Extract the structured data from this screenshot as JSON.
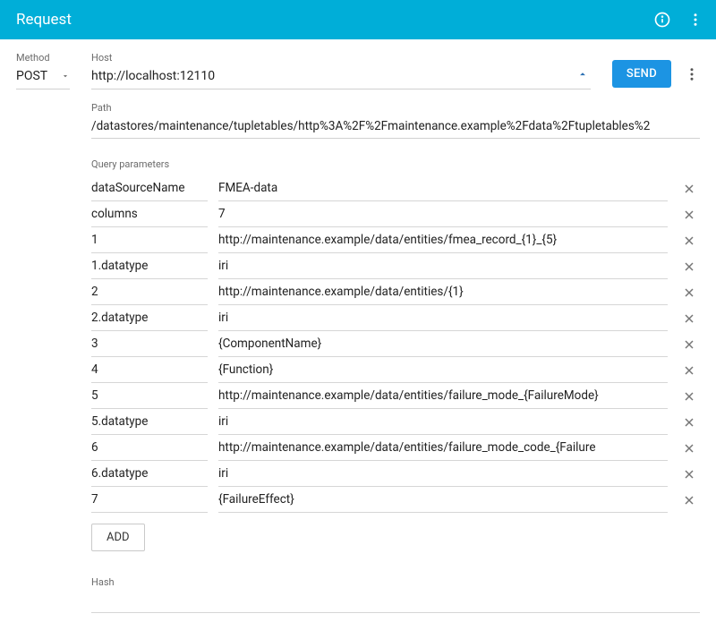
{
  "header": {
    "title": "Request"
  },
  "method": {
    "label": "Method",
    "value": "POST"
  },
  "host": {
    "label": "Host",
    "value": "http://localhost:12110"
  },
  "send_label": "SEND",
  "path": {
    "label": "Path",
    "value": "/datastores/maintenance/tupletables/http%3A%2F%2Fmaintenance.example%2Fdata%2Ftupletables%2"
  },
  "query_params_label": "Query parameters",
  "params": [
    {
      "key": "dataSourceName",
      "val": "FMEA-data"
    },
    {
      "key": "columns",
      "val": "7"
    },
    {
      "key": "1",
      "val": "http://maintenance.example/data/entities/fmea_record_{1}_{5}"
    },
    {
      "key": "1.datatype",
      "val": "iri"
    },
    {
      "key": "2",
      "val": "http://maintenance.example/data/entities/{1}"
    },
    {
      "key": "2.datatype",
      "val": "iri"
    },
    {
      "key": "3",
      "val": "{ComponentName}"
    },
    {
      "key": "4",
      "val": "{Function}"
    },
    {
      "key": "5",
      "val": "http://maintenance.example/data/entities/failure_mode_{FailureMode}"
    },
    {
      "key": "5.datatype",
      "val": "iri"
    },
    {
      "key": "6",
      "val": "http://maintenance.example/data/entities/failure_mode_code_{Failure"
    },
    {
      "key": "6.datatype",
      "val": "iri"
    },
    {
      "key": "7",
      "val": "{FailureEffect}"
    }
  ],
  "add_label": "ADD",
  "hash_label": "Hash"
}
